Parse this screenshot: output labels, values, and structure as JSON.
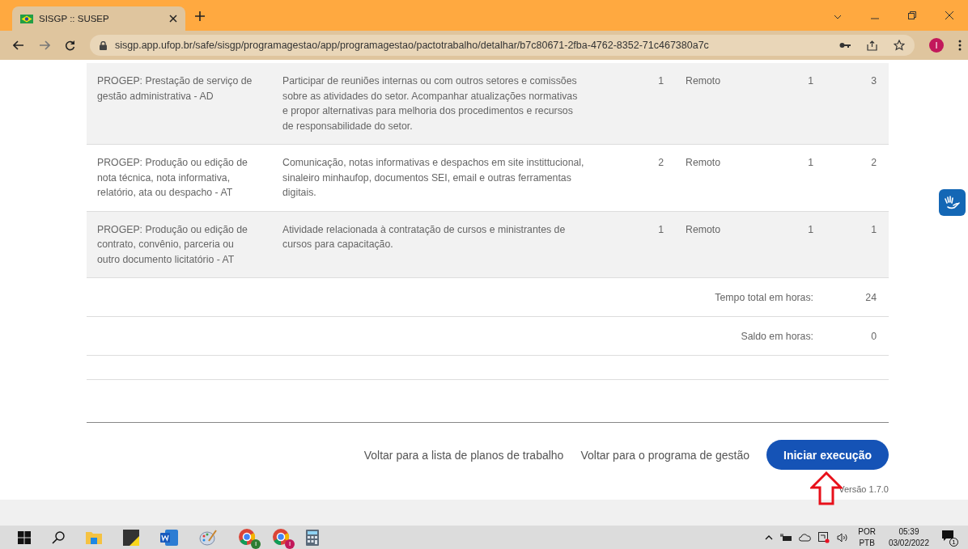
{
  "browser": {
    "tab_title": "SISGP :: SUSEP",
    "url": "sisgp.app.ufop.br/safe/sisgp/programagestao/app/programagestao/pactotrabalho/detalhar/b7c80671-2fba-4762-8352-71c467380a7c",
    "profile_initial": "I"
  },
  "activities": [
    {
      "activity": "PROGEP: Prestação de serviço de gestão administrativa - AD",
      "description": "Participar de reuniões internas ou com outros setores e comissões sobre as atividades do setor. Acompanhar atualizações normativas e propor alternativas para melhoria dos procedimentos e recursos de responsabilidade do setor.",
      "column_3": "1",
      "mode": "Remoto",
      "column_5": "1",
      "column_6": "3"
    },
    {
      "activity": "PROGEP: Produção ou edição de nota técnica, nota informativa, relatório, ata ou despacho - AT",
      "description": "Comunicação, notas informativas e despachos em site instittucional, sinaleiro minhaufop, documentos SEI, email e outras ferramentas digitais.",
      "column_3": "2",
      "mode": "Remoto",
      "column_5": "1",
      "column_6": "2"
    },
    {
      "activity": "PROGEP: Produção ou edição de contrato, convênio, parceria ou outro documento licitatório - AT",
      "description": "Atividade relacionada à contratação de cursos e ministrantes de cursos para capacitação.",
      "column_3": "1",
      "mode": "Remoto",
      "column_5": "1",
      "column_6": "1"
    }
  ],
  "totals": [
    {
      "label": "Tempo total em horas:",
      "value": "24"
    },
    {
      "label": "Saldo em horas:",
      "value": "0"
    }
  ],
  "actions": {
    "links": [
      "Voltar para a lista de planos de trabalho",
      "Voltar para o programa de gestão"
    ],
    "primary_button": "Iniciar execução"
  },
  "version": "Versão 1.7.0",
  "taskbar": {
    "chrome_profiles": [
      {
        "initial": "I",
        "color": "#2e7d32"
      },
      {
        "initial": "I",
        "color": "#c2185b"
      }
    ],
    "language": "POR",
    "layout": "PTB",
    "time": "05:39",
    "date": "03/02/2022",
    "notifications": "1"
  }
}
